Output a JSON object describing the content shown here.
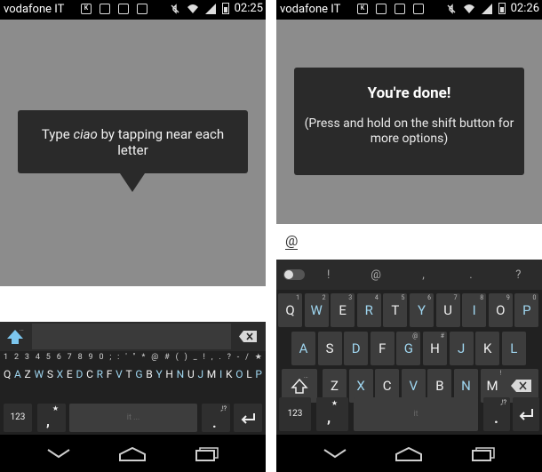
{
  "left": {
    "status": {
      "carrier": "vodafone IT",
      "time": "02:25"
    },
    "tooltip_html_parts": {
      "before": "Type ",
      "emph": "ciao",
      "after": " by tapping near each letter"
    },
    "keyboard": {
      "symbols": [
        "1",
        "2",
        "3",
        "4",
        "5",
        "6",
        "7",
        "8",
        "9",
        "0",
        ";",
        ":",
        "'",
        "\"",
        "*",
        "@",
        "#",
        "(",
        ")",
        "_",
        "!",
        ",",
        ".",
        "?",
        "-",
        "/",
        "★"
      ],
      "letters": [
        "Q",
        "A",
        "Z",
        "W",
        "S",
        "X",
        "E",
        "D",
        "C",
        "R",
        "F",
        "V",
        "T",
        "G",
        "B",
        "Y",
        "H",
        "N",
        "U",
        "J",
        "M",
        "I",
        "K",
        "O",
        "L",
        "P"
      ],
      "key_123": "123",
      "comma_key": ",",
      "period_key": ".",
      "space_hint": "it",
      "period_sup": ",!?",
      "comma_sup": "★"
    }
  },
  "right": {
    "status": {
      "carrier": "vodafone IT",
      "time": "02:26"
    },
    "done_title": "You're done!",
    "done_sub": "(Press and hold on the shift button for more options)",
    "typed_text": "@",
    "suggest_syms": [
      "!",
      "@",
      ",",
      ".",
      "?"
    ],
    "row1": [
      {
        "k": "Q",
        "s": "1"
      },
      {
        "k": "W",
        "s": "2"
      },
      {
        "k": "E",
        "s": "3"
      },
      {
        "k": "R",
        "s": "4"
      },
      {
        "k": "T",
        "s": "5"
      },
      {
        "k": "Y",
        "s": "6"
      },
      {
        "k": "U",
        "s": "7"
      },
      {
        "k": "I",
        "s": "8"
      },
      {
        "k": "O",
        "s": "9"
      },
      {
        "k": "P",
        "s": "0"
      }
    ],
    "row2": [
      {
        "k": "A",
        "s": ""
      },
      {
        "k": "S",
        "s": ""
      },
      {
        "k": "D",
        "s": ""
      },
      {
        "k": "F",
        "s": ""
      },
      {
        "k": "G",
        "s": "@"
      },
      {
        "k": "H",
        "s": "#"
      },
      {
        "k": "J",
        "s": ""
      },
      {
        "k": "K",
        "s": ""
      },
      {
        "k": "L",
        "s": ""
      }
    ],
    "row3": [
      {
        "k": "Z",
        "s": ""
      },
      {
        "k": "X",
        "s": ""
      },
      {
        "k": "C",
        "s": ""
      },
      {
        "k": "V",
        "s": ""
      },
      {
        "k": "B",
        "s": ""
      },
      {
        "k": "N",
        "s": ""
      },
      {
        "k": "M",
        "s": "!"
      }
    ],
    "key_123": "123",
    "comma_key": ",",
    "period_key": ".",
    "space_hint": "it",
    "period_sup": ",!?",
    "comma_sup": "★"
  }
}
